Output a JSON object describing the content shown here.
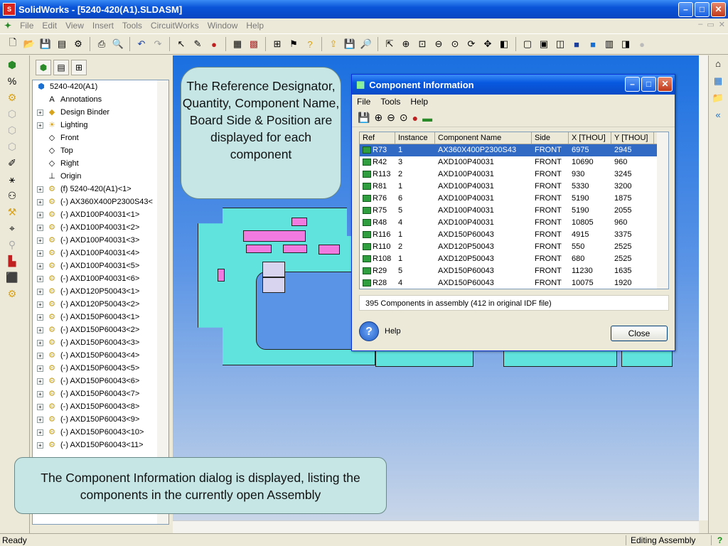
{
  "app": {
    "title": "SolidWorks - [5240-420(A1).SLDASM]",
    "logo": "S",
    "min_icon": "–",
    "max_icon": "□",
    "close_icon": "✕"
  },
  "menu": [
    "File",
    "Edit",
    "View",
    "Insert",
    "Tools",
    "CircuitWorks",
    "Window",
    "Help"
  ],
  "feature_tree": {
    "root": "5240-420(A1)",
    "items": [
      {
        "label": "Annotations",
        "icon": "annotations-icon",
        "expand": false
      },
      {
        "label": "Design Binder",
        "icon": "design-binder-icon",
        "expand": true
      },
      {
        "label": "Lighting",
        "icon": "lighting-icon",
        "expand": true
      },
      {
        "label": "Front",
        "icon": "plane-icon",
        "expand": false
      },
      {
        "label": "Top",
        "icon": "plane-icon",
        "expand": false
      },
      {
        "label": "Right",
        "icon": "plane-icon",
        "expand": false
      },
      {
        "label": "Origin",
        "icon": "origin-icon",
        "expand": false
      },
      {
        "label": "(f) 5240-420(A1)<1>",
        "icon": "component-icon",
        "expand": true
      },
      {
        "label": "(-) AX360X400P2300S43<",
        "icon": "component-icon",
        "expand": true
      },
      {
        "label": "(-) AXD100P40031<1>",
        "icon": "component-icon",
        "expand": true
      },
      {
        "label": "(-) AXD100P40031<2>",
        "icon": "component-icon",
        "expand": true
      },
      {
        "label": "(-) AXD100P40031<3>",
        "icon": "component-icon",
        "expand": true
      },
      {
        "label": "(-) AXD100P40031<4>",
        "icon": "component-icon",
        "expand": true
      },
      {
        "label": "(-) AXD100P40031<5>",
        "icon": "component-icon",
        "expand": true
      },
      {
        "label": "(-) AXD100P40031<6>",
        "icon": "component-icon",
        "expand": true
      },
      {
        "label": "(-) AXD120P50043<1>",
        "icon": "component-icon",
        "expand": true
      },
      {
        "label": "(-) AXD120P50043<2>",
        "icon": "component-icon",
        "expand": true
      },
      {
        "label": "(-) AXD150P60043<1>",
        "icon": "component-icon",
        "expand": true
      },
      {
        "label": "(-) AXD150P60043<2>",
        "icon": "component-icon",
        "expand": true
      },
      {
        "label": "(-) AXD150P60043<3>",
        "icon": "component-icon",
        "expand": true
      },
      {
        "label": "(-) AXD150P60043<4>",
        "icon": "component-icon",
        "expand": true
      },
      {
        "label": "(-) AXD150P60043<5>",
        "icon": "component-icon",
        "expand": true
      },
      {
        "label": "(-) AXD150P60043<6>",
        "icon": "component-icon",
        "expand": true
      },
      {
        "label": "(-) AXD150P60043<7>",
        "icon": "component-icon",
        "expand": true
      },
      {
        "label": "(-) AXD150P60043<8>",
        "icon": "component-icon",
        "expand": true
      },
      {
        "label": "(-) AXD150P60043<9>",
        "icon": "component-icon",
        "expand": true
      },
      {
        "label": "(-) AXD150P60043<10>",
        "icon": "component-icon",
        "expand": true
      },
      {
        "label": "(-) AXD150P60043<11>",
        "icon": "component-icon",
        "expand": true
      }
    ]
  },
  "dialog": {
    "title": "Component Information",
    "menu": [
      "File",
      "Tools",
      "Help"
    ],
    "columns": [
      "Ref",
      "Instance",
      "Component Name",
      "Side",
      "X [THOU]",
      "Y [THOU]"
    ],
    "rows": [
      [
        "R73",
        "1",
        "AX360X400P2300S43",
        "FRONT",
        "6975",
        "2945"
      ],
      [
        "R42",
        "3",
        "AXD100P40031",
        "FRONT",
        "10690",
        "960"
      ],
      [
        "R113",
        "2",
        "AXD100P40031",
        "FRONT",
        "930",
        "3245"
      ],
      [
        "R81",
        "1",
        "AXD100P40031",
        "FRONT",
        "5330",
        "3200"
      ],
      [
        "R76",
        "6",
        "AXD100P40031",
        "FRONT",
        "5190",
        "1875"
      ],
      [
        "R75",
        "5",
        "AXD100P40031",
        "FRONT",
        "5190",
        "2055"
      ],
      [
        "R48",
        "4",
        "AXD100P40031",
        "FRONT",
        "10805",
        "960"
      ],
      [
        "R116",
        "1",
        "AXD150P60043",
        "FRONT",
        "4915",
        "3375"
      ],
      [
        "R110",
        "2",
        "AXD120P50043",
        "FRONT",
        "550",
        "2525"
      ],
      [
        "R108",
        "1",
        "AXD120P50043",
        "FRONT",
        "680",
        "2525"
      ],
      [
        "R29",
        "5",
        "AXD150P60043",
        "FRONT",
        "11230",
        "1635"
      ],
      [
        "R28",
        "4",
        "AXD150P60043",
        "FRONT",
        "10075",
        "1920"
      ]
    ],
    "selected_row": 0,
    "summary": "395 Components in assembly (412 in original IDF file)",
    "help_label": "Help",
    "help_icon": "?",
    "close_label": "Close"
  },
  "callouts": {
    "top": "The Reference Designator, Quantity, Component Name, Board Side & Position are displayed for each component",
    "bottom": "The Component Information dialog is displayed, listing the components in the currently open Assembly"
  },
  "status": {
    "left": "Ready",
    "mode": "Editing Assembly",
    "help": "?"
  }
}
